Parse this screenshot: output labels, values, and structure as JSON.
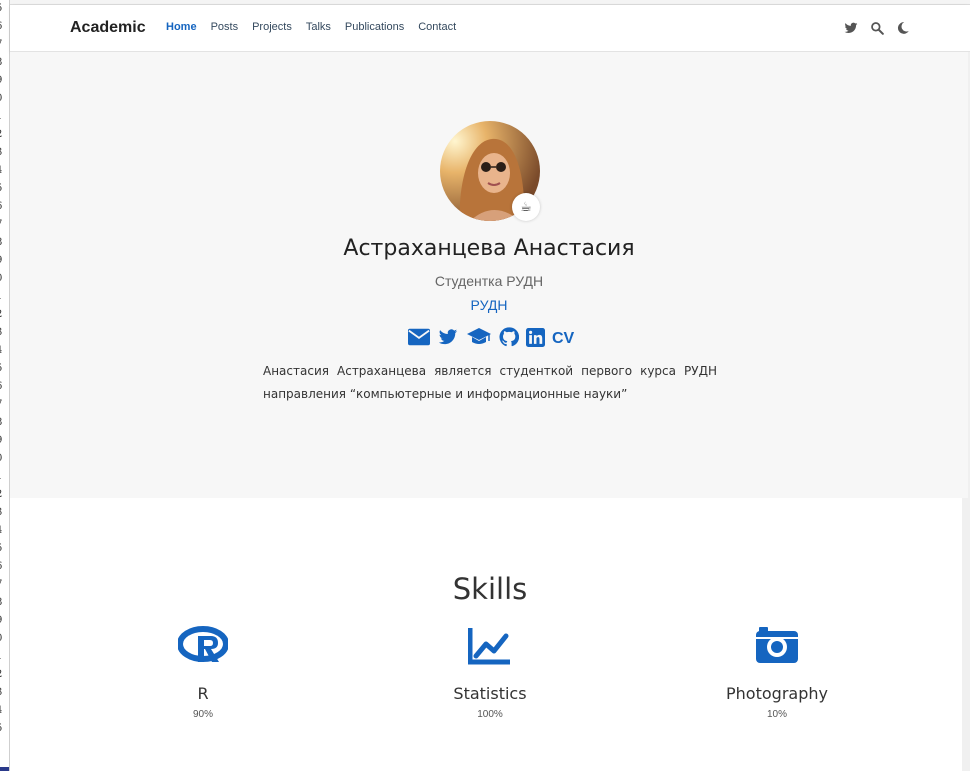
{
  "gutter": {
    "numbers": [
      "5",
      "6",
      "7",
      "8",
      "9",
      "0",
      "1",
      "2",
      "3",
      "4",
      "5",
      "6",
      "7",
      "8",
      "9",
      "0",
      "1",
      "2",
      "3",
      "4",
      "5",
      "6",
      "7",
      "8",
      "9",
      "0",
      "1",
      "2",
      "3",
      "4",
      "5",
      "6",
      "7",
      "8",
      "9",
      "0",
      "1",
      "2",
      "3",
      "4",
      "5"
    ]
  },
  "navbar": {
    "brand": "Academic",
    "items": [
      {
        "label": "Home",
        "active": true
      },
      {
        "label": "Posts",
        "active": false
      },
      {
        "label": "Projects",
        "active": false
      },
      {
        "label": "Talks",
        "active": false
      },
      {
        "label": "Publications",
        "active": false
      },
      {
        "label": "Contact",
        "active": false
      }
    ],
    "icons": [
      "twitter-icon",
      "search-icon",
      "moon-icon"
    ]
  },
  "profile": {
    "status_emoji": "☕",
    "name": "Астраханцева Анастасия",
    "role": "Студентка РУДН",
    "organization": "РУДН",
    "social_icons": [
      "envelope-icon",
      "twitter-icon",
      "graduation-cap-icon",
      "github-icon",
      "linkedin-icon"
    ],
    "cv_label": "CV",
    "bio": "Анастасия Астраханцева является студенткой первого курса РУДН направления “компьютерные и информационные науки”"
  },
  "skills": {
    "title": "Skills",
    "items": [
      {
        "name": "R",
        "percent": "90%",
        "icon": "r-logo-icon"
      },
      {
        "name": "Statistics",
        "percent": "100%",
        "icon": "chart-line-icon"
      },
      {
        "name": "Photography",
        "percent": "10%",
        "icon": "camera-icon"
      }
    ]
  },
  "colors": {
    "accent": "#1565c0",
    "hero_bg": "#f7f7f7",
    "text": "#222222"
  }
}
